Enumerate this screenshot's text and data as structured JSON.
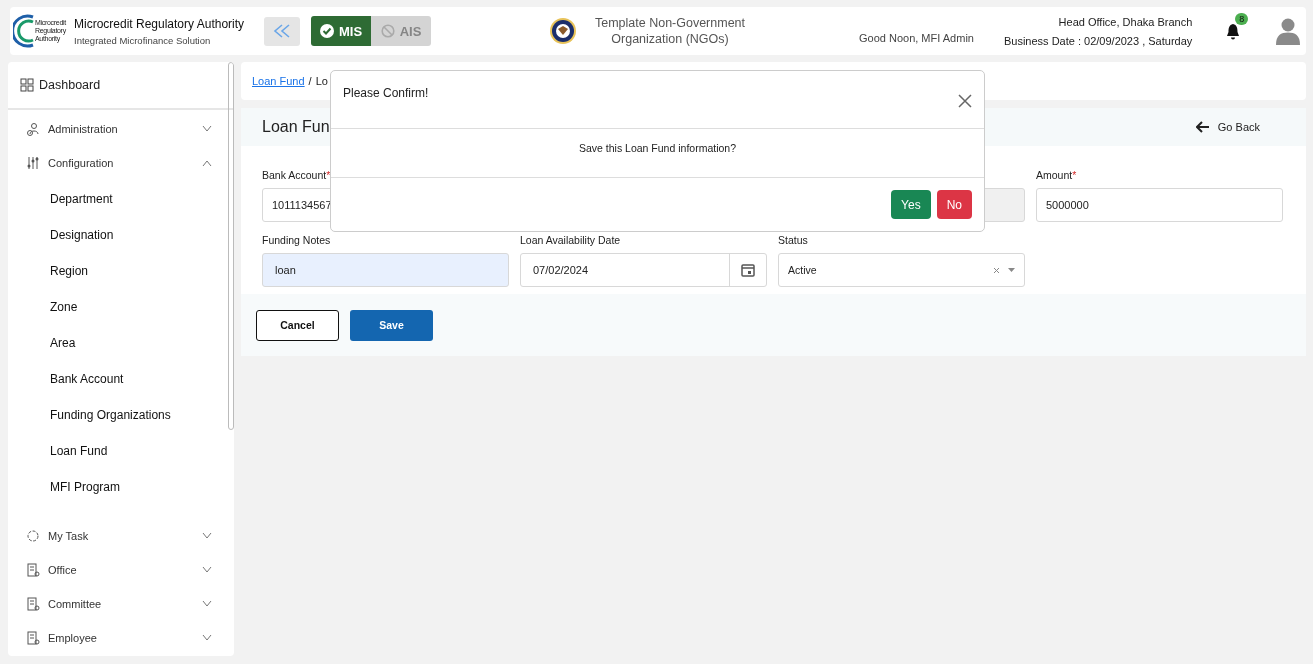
{
  "header": {
    "logo_text": [
      "Microcredit",
      "Regulatory",
      "Authority"
    ],
    "title": "Microcredit Regulatory Authority",
    "subtitle": "Integrated Microfinance Solution",
    "modules": [
      {
        "label": "MIS",
        "selected": true
      },
      {
        "label": "AIS",
        "selected": false
      }
    ],
    "organization": "Template Non-Government Organization (NGOs)",
    "greeting": "Good Noon, MFI Admin",
    "branch": "Head Office, Dhaka Branch",
    "business_date": "Business Date : 02/09/2023 , Saturday",
    "notifications": "8"
  },
  "sidebar": {
    "items": [
      {
        "label": "Dashboard",
        "kind": "grid"
      },
      {
        "label": "Administration",
        "kind": "users",
        "expanded": false
      },
      {
        "label": "Configuration",
        "kind": "sliders",
        "expanded": true,
        "children": [
          {
            "label": "Department"
          },
          {
            "label": "Designation"
          },
          {
            "label": "Region"
          },
          {
            "label": "Zone"
          },
          {
            "label": "Area"
          },
          {
            "label": "Bank Account"
          },
          {
            "label": "Funding Organizations"
          },
          {
            "label": "Loan Fund"
          },
          {
            "label": "MFI Program"
          }
        ]
      },
      {
        "label": "My Task",
        "kind": "circle",
        "expanded": false
      },
      {
        "label": "Office",
        "kind": "doc",
        "expanded": false
      },
      {
        "label": "Committee",
        "kind": "doc",
        "expanded": false
      },
      {
        "label": "Employee",
        "kind": "doc",
        "expanded": false
      }
    ]
  },
  "breadcrumb": [
    {
      "label": "Loan Fund",
      "kind": "link"
    },
    {
      "label": "/",
      "kind": "separator"
    },
    {
      "label": "Lo",
      "kind": "text"
    }
  ],
  "page": {
    "title": "Loan Fun",
    "go_back": "Go Back"
  },
  "form": {
    "fields": [
      {
        "label": "Bank Account",
        "required_mark": "*",
        "value": "1011134567",
        "kind": "text"
      },
      {
        "kind": "hidden"
      },
      {
        "kind": "text",
        "disabled": true
      },
      {
        "label": "Amount",
        "required_mark": "*",
        "value": "5000000",
        "kind": "text"
      },
      {
        "label": "Funding Notes",
        "value": "loan",
        "kind": "text",
        "autofilled": true
      },
      {
        "label": "Loan Availability Date",
        "value": "07/02/2024",
        "kind": "date"
      },
      {
        "label": "Status",
        "value": "Active",
        "kind": "select"
      }
    ],
    "buttons": [
      {
        "label": "Cancel",
        "kind": "outline"
      },
      {
        "label": "Save",
        "kind": "primary"
      }
    ]
  },
  "modal": {
    "title": "Please Confirm!",
    "message": "Save this Loan Fund information?",
    "buttons": [
      {
        "label": "Yes",
        "kind": "success"
      },
      {
        "label": "No",
        "kind": "danger"
      }
    ]
  }
}
